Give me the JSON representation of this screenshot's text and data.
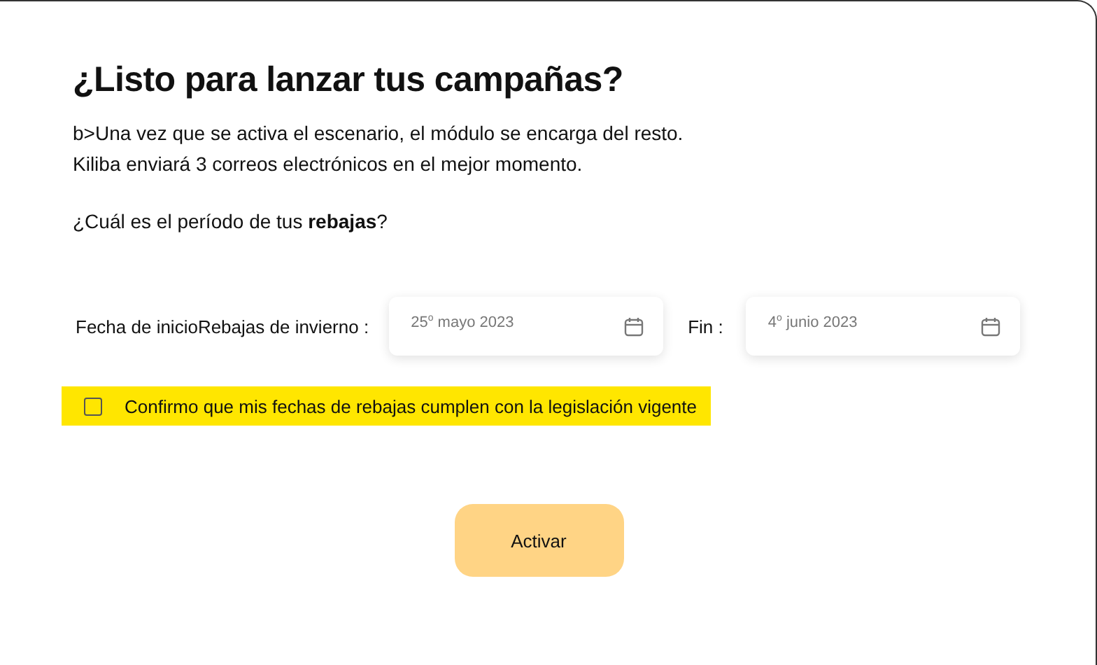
{
  "title": "¿Listo para lanzar tus campañas?",
  "intro": [
    "b>Una vez que se activa el escenario, el módulo se encarga del resto.",
    "Kiliba enviará 3 correos electrónicos en el mejor momento."
  ],
  "question": "¿Cuál es el período de tus **rebajas**?",
  "start": {
    "label": "Fecha de inicioRebajas de invierno :",
    "value": "25$^{o}$ mayo 2023"
  },
  "end": {
    "label": "Fin :",
    "value": "4$^{o}$ junio 2023"
  },
  "confirm": {
    "label": "Confirmo que mis fechas de rebajas cumplen con la legislación vigente",
    "checked": false
  },
  "button": "Activar"
}
